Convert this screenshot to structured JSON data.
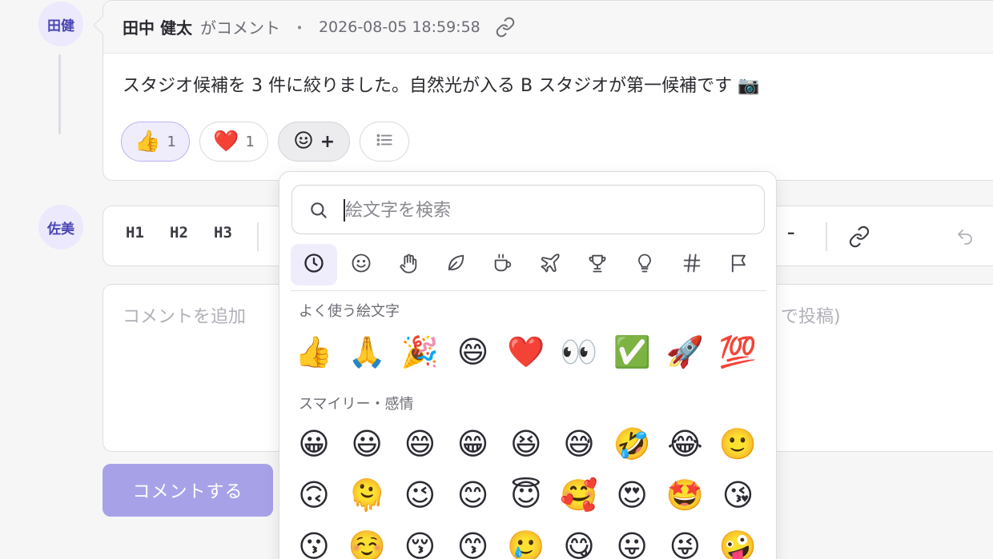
{
  "comment": {
    "avatar": "田健",
    "author": "田中 健太",
    "action": "がコメント",
    "separator": "・",
    "timestamp": "2026-08-05 18:59:58",
    "body": "スタジオ候補を 3 件に絞りました。自然光が入る B スタジオが第一候補です 📷",
    "reactions": [
      {
        "emoji": "👍",
        "count": "1",
        "active": true
      },
      {
        "emoji": "❤️",
        "count": "1",
        "active": false
      }
    ],
    "add_reaction_icon": "smile-plus-icon",
    "add_reaction_plus": "+",
    "list_icon": "list-icon"
  },
  "reply": {
    "avatar": "佐美",
    "toolbar": {
      "h1": "H1",
      "h2": "H2",
      "h3": "H3",
      "minus": "–"
    },
    "editor_placeholder": "コメントを追加",
    "editor_hint": "r で投稿)",
    "submit_label": "コメントする"
  },
  "emoji_picker": {
    "search_placeholder": "絵文字を検索",
    "categories": [
      "recent-clock-icon",
      "smiley-icon",
      "hand-icon",
      "leaf-icon",
      "cup-icon",
      "plane-icon",
      "trophy-icon",
      "bulb-icon",
      "hash-icon",
      "flag-icon"
    ],
    "active_category": 0,
    "frequent_title": "よく使う絵文字",
    "frequent": [
      "👍",
      "🙏",
      "🎉",
      "😄",
      "❤️",
      "👀",
      "✅",
      "🚀",
      "💯"
    ],
    "smileys_title": "スマイリー・感情",
    "smileys": [
      [
        "😀",
        "😃",
        "😄",
        "😁",
        "😆",
        "😅",
        "🤣",
        "😂",
        "🙂"
      ],
      [
        "🙃",
        "🫠",
        "😉",
        "😊",
        "😇",
        "🥰",
        "😍",
        "🤩",
        "😘"
      ],
      [
        "😗",
        "☺️",
        "😚",
        "😙",
        "🥲",
        "😋",
        "😛",
        "😜",
        "🤪"
      ]
    ]
  },
  "colors": {
    "accent": "#5b54d6",
    "accent_soft": "#efedfc",
    "submit": "#a7a2e8"
  }
}
